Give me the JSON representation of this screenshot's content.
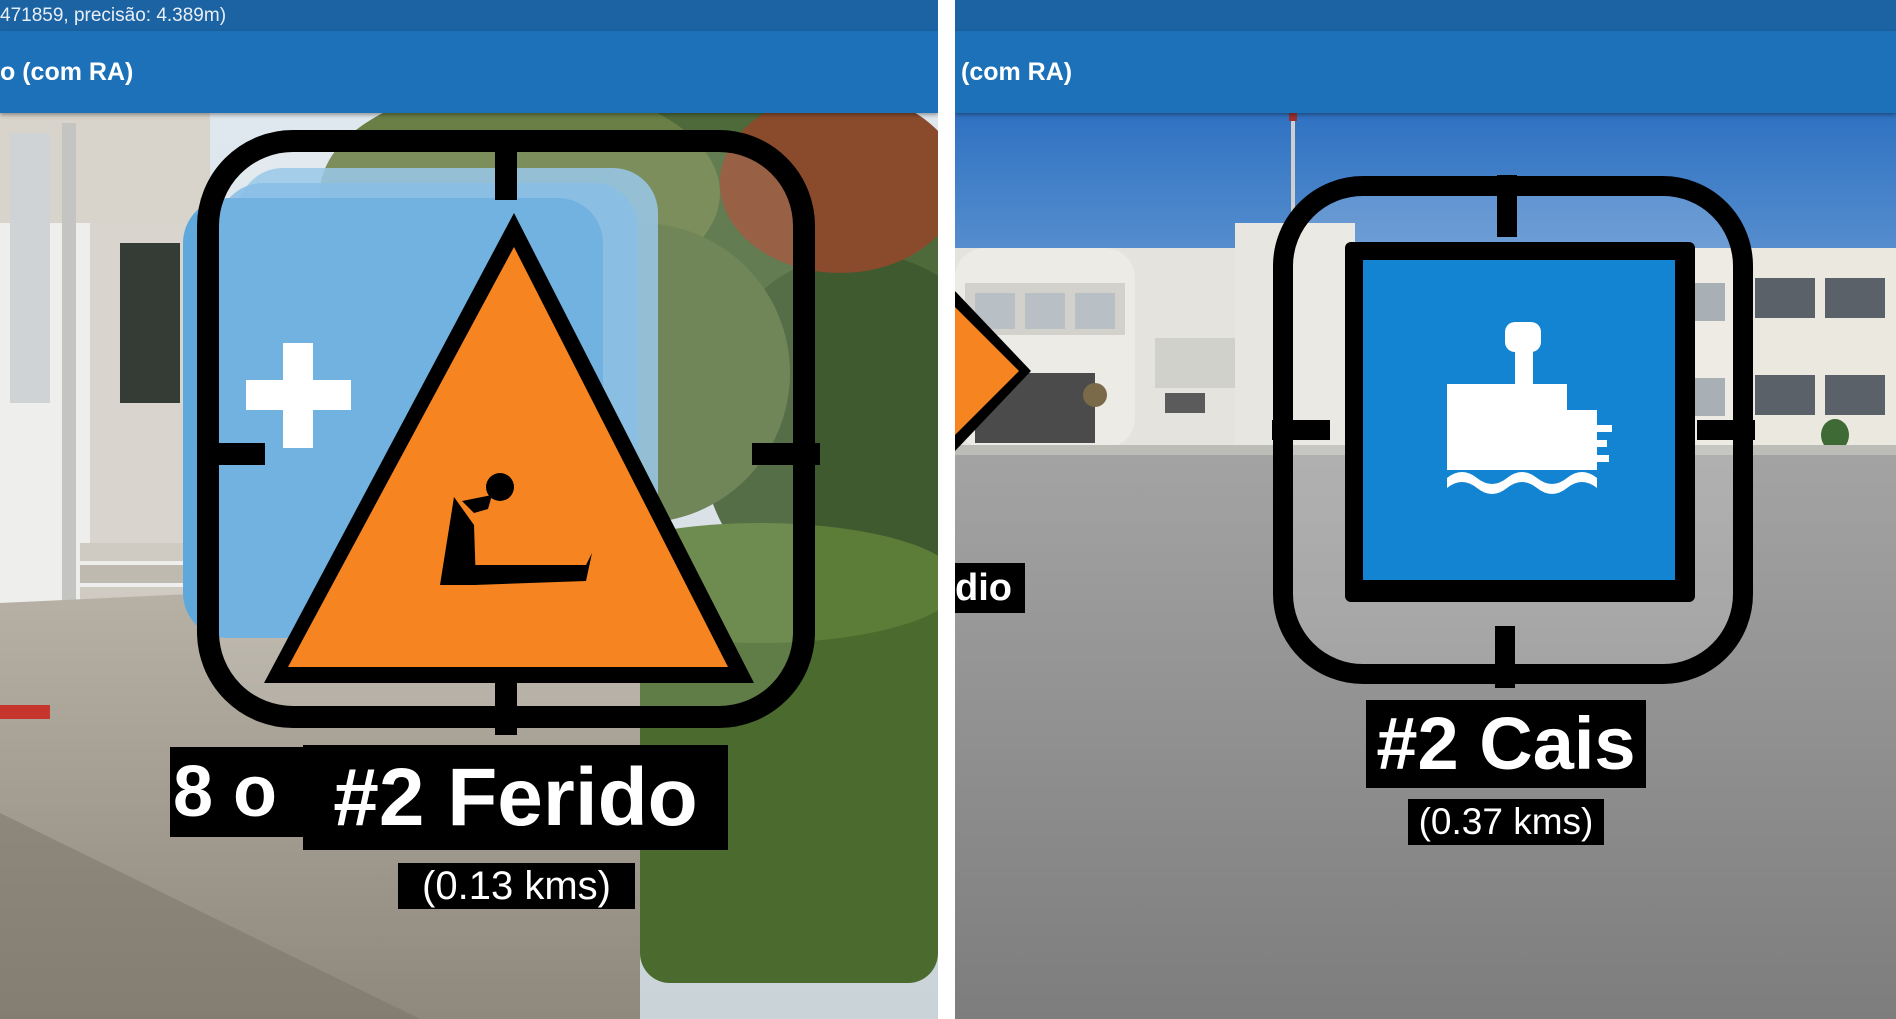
{
  "left_screen": {
    "status_text": "471859, precisão: 4.389m)",
    "app_title": "o (com RA)",
    "background_marker_label": "8 o",
    "marker": {
      "label": "#2 Ferido",
      "distance": "(0.13 kms)",
      "icon": "injured-person-warning-icon",
      "color": "#f68521"
    },
    "background_marker": {
      "icon": "first-aid-cross-icon",
      "color": "#5fa8dc"
    }
  },
  "right_screen": {
    "status_text": "",
    "app_title": "(com RA)",
    "offscreen_label": "dio",
    "marker": {
      "label": "#2 Cais",
      "distance": "(0.37 kms)",
      "icon": "boat-pier-icon",
      "color": "#1284d1"
    },
    "offscreen_marker": {
      "icon": "orange-arrow-icon",
      "color": "#f68521"
    }
  },
  "colors": {
    "statusbar": "#1b63a2",
    "appbar": "#1d71b8",
    "marker_frame": "#000000",
    "label_background": "#000000"
  }
}
